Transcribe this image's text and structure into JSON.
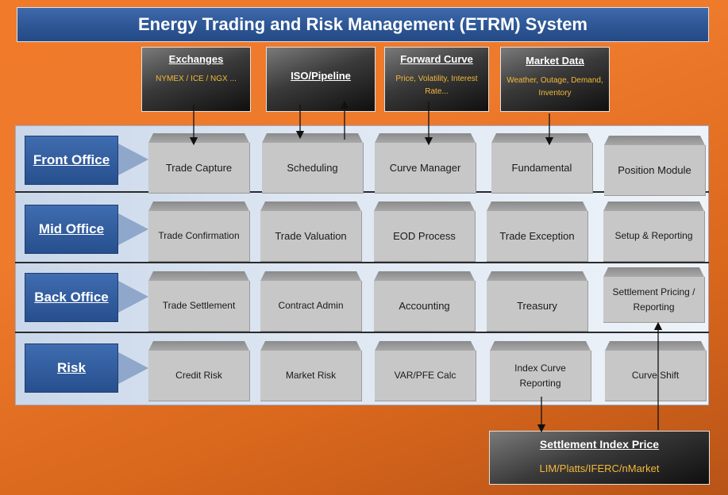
{
  "title": "Energy Trading and Risk Management (ETRM) System",
  "sources": [
    {
      "title": "Exchanges",
      "subtitle": "NYMEX / ICE / NGX ..."
    },
    {
      "title": "ISO/Pipeline",
      "subtitle": ""
    },
    {
      "title": "Forward Curve",
      "subtitle": "Price, Volatility, Interest Rate..."
    },
    {
      "title": "Market Data",
      "subtitle": "Weather, Outage, Demand, Inventory"
    }
  ],
  "rows": [
    {
      "label": "Front Office",
      "modules": [
        "Trade Capture",
        "Scheduling",
        "Curve Manager",
        "Fundamental",
        "Position Module"
      ]
    },
    {
      "label": "Mid Office",
      "modules": [
        "Trade Confirmation",
        "Trade Valuation",
        "EOD Process",
        "Trade Exception",
        "Setup & Reporting"
      ]
    },
    {
      "label": "Back Office",
      "modules": [
        "Trade Settlement",
        "Contract Admin",
        "Accounting",
        "Treasury",
        "Settlement Pricing / Reporting"
      ]
    },
    {
      "label": "Risk",
      "modules": [
        "Credit Risk",
        "Market Risk",
        "VAR/PFE Calc",
        "Index Curve Reporting",
        "Curve Shift"
      ]
    }
  ],
  "settlement": {
    "title": "Settlement Index Price",
    "subtitle": "LIM/Platts/IFERC/nMarket"
  },
  "colors": {
    "background": "#ee7a2c",
    "title_bar": "#2d5695",
    "office_label": "#2f5b9d",
    "module": "#c7c7c7",
    "source_subtitle": "#f5b93a"
  }
}
